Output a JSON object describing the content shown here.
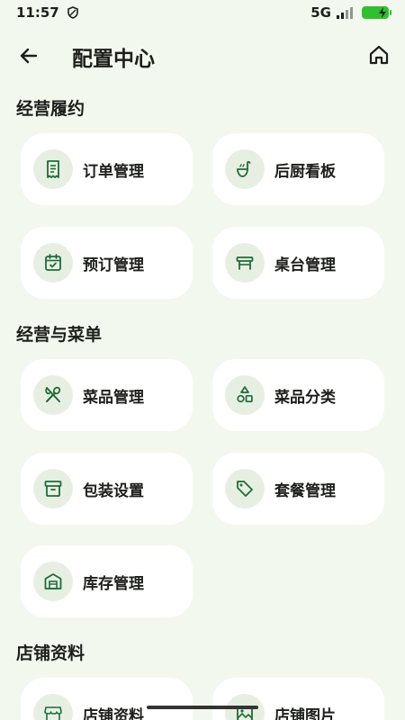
{
  "status_bar": {
    "time": "11:57",
    "network": "5G",
    "battery_color": "#2fbf2f"
  },
  "header": {
    "title": "配置中心",
    "back_icon": "arrow-left-icon",
    "home_icon": "home-icon"
  },
  "sections": [
    {
      "title": "经营履约",
      "items": [
        {
          "label": "订单管理",
          "icon": "receipt-icon"
        },
        {
          "label": "后厨看板",
          "icon": "ladle-icon"
        },
        {
          "label": "预订管理",
          "icon": "calendar-check-icon"
        },
        {
          "label": "桌台管理",
          "icon": "table-icon"
        }
      ]
    },
    {
      "title": "经营与菜单",
      "items": [
        {
          "label": "菜品管理",
          "icon": "utensils-icon"
        },
        {
          "label": "菜品分类",
          "icon": "shapes-icon"
        },
        {
          "label": "包装设置",
          "icon": "archive-box-icon"
        },
        {
          "label": "套餐管理",
          "icon": "tag-icon"
        },
        {
          "label": "库存管理",
          "icon": "warehouse-icon"
        }
      ]
    },
    {
      "title": "店铺资料",
      "items": [
        {
          "label": "店铺资料",
          "icon": "store-icon"
        },
        {
          "label": "店铺图片",
          "icon": "image-icon"
        }
      ]
    }
  ],
  "colors": {
    "background": "#f3f8ef",
    "accent": "#1f6b3a",
    "icon_bg": "#e7efe2",
    "card_bg": "#ffffff"
  }
}
